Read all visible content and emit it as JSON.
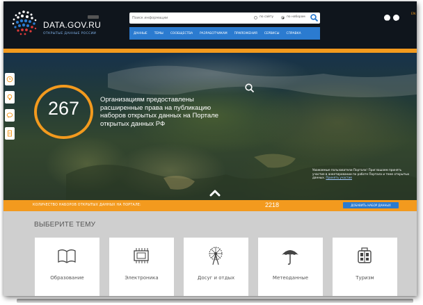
{
  "header": {
    "logo_title": "DATA.GOV.RU",
    "logo_subtitle": "ОТКРЫТЫЕ ДАННЫЕ РОССИИ",
    "search": {
      "placeholder": "Поиск информации",
      "scope_options": [
        "по сайту",
        "по наборам"
      ],
      "selected_scope": "по наборам"
    },
    "nav": [
      "ДАННЫЕ",
      "ТЕМЫ",
      "СООБЩЕСТВА",
      "РАЗРАБОТЧИКАМ",
      "ПРИЛОЖЕНИЯ",
      "СЕРВИСЫ",
      "СПРАВКА"
    ],
    "lang": "EN"
  },
  "hero": {
    "count": "267",
    "text": "Организациям предоставлены расширенные права на публикацию наборов открытых данных на Портале открытых данных РФ",
    "notice": "Уважаемые пользователи Портала! Приглашаем принять участие в анкетировании по работе Портала и теме открытых данных.",
    "notice_link": "Принять участие"
  },
  "count_bar": {
    "label": "КОЛИЧЕСТВО НАБОРОВ ОТКРЫТЫХ ДАННЫХ НА ПОРТАЛЕ:",
    "value": "2218",
    "add_button": "ДОБАВИТЬ НАБОР ДАННЫХ"
  },
  "topics": {
    "title": "ВЫБЕРИТЕ ТЕМУ",
    "items": [
      {
        "label": "Образование",
        "icon": "book-icon"
      },
      {
        "label": "Электроника",
        "icon": "chip-icon"
      },
      {
        "label": "Досуг и отдых",
        "icon": "ferris-wheel-icon"
      },
      {
        "label": "Метеоданные",
        "icon": "umbrella-icon"
      },
      {
        "label": "Туризм",
        "icon": "luggage-icon"
      }
    ]
  },
  "colors": {
    "accent_orange": "#f39a1e",
    "nav_blue": "#2b7bd0",
    "header_bg": "#0f151c"
  }
}
